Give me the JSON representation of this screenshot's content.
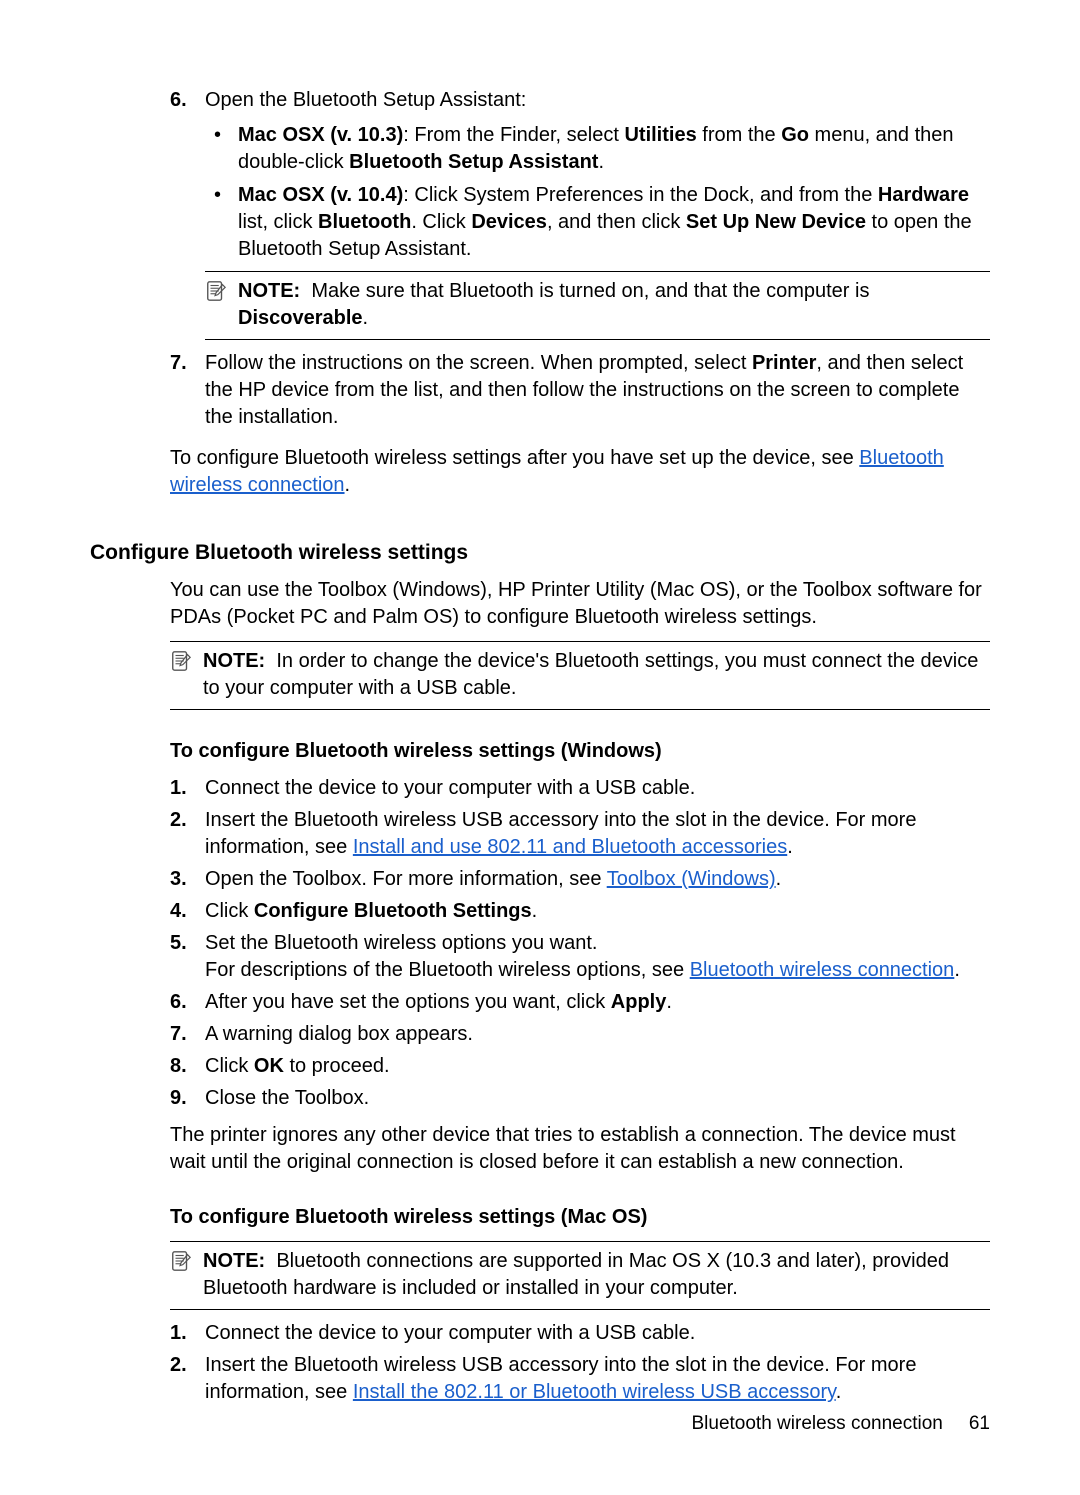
{
  "step6": {
    "num": "6.",
    "text": "Open the Bluetooth Setup Assistant:",
    "bul_a": {
      "lead_bold": "Mac OSX (v. 10.3)",
      "colon": ": From the Finder, select ",
      "u1": "Utilities",
      "mid1": " from the ",
      "u2": "Go",
      "mid2": " menu, and then double-click ",
      "u3": "Bluetooth Setup Assistant",
      "end": "."
    },
    "bul_b": {
      "lead_bold": "Mac OSX (v. 10.4)",
      "colon": ": Click System Preferences in the Dock, and from the ",
      "u1": "Hardware",
      "mid1": " list, click ",
      "u2": "Bluetooth",
      "mid2": ". Click ",
      "u3": "Devices",
      "mid3": ", and then click ",
      "u4": "Set Up New Device",
      "end": " to open the Bluetooth Setup Assistant."
    }
  },
  "note1": {
    "label": "NOTE:",
    "t1": "Make sure that Bluetooth is turned on, and that the computer is ",
    "b1": "Discoverable",
    "t2": "."
  },
  "step7": {
    "num": "7.",
    "t1": "Follow the instructions on the screen. When prompted, select ",
    "b1": "Printer",
    "t2": ", and then select the HP device from the list, and then follow the instructions on the screen to complete the installation."
  },
  "para_after7": {
    "t1": "To configure Bluetooth wireless settings after you have set up the device, see ",
    "link": "Bluetooth wireless connection",
    "t2": "."
  },
  "sec1": {
    "heading": "Configure Bluetooth wireless settings",
    "intro": "You can use the Toolbox (Windows), HP Printer Utility (Mac OS), or the Toolbox software for PDAs (Pocket PC and Palm OS) to configure Bluetooth wireless settings."
  },
  "note2": {
    "label": "NOTE:",
    "text": "In order to change the device's Bluetooth settings, you must connect the device to your computer with a USB cable."
  },
  "win": {
    "heading": "To configure Bluetooth wireless settings (Windows)",
    "s1": {
      "num": "1.",
      "text": "Connect the device to your computer with a USB cable."
    },
    "s2": {
      "num": "2.",
      "t1": "Insert the Bluetooth wireless USB accessory into the slot in the device. For more information, see ",
      "link": "Install and use 802.11 and Bluetooth accessories",
      "t2": "."
    },
    "s3": {
      "num": "3.",
      "t1": "Open the Toolbox. For more information, see ",
      "link": "Toolbox (Windows)",
      "t2": "."
    },
    "s4": {
      "num": "4.",
      "t1": "Click ",
      "b1": "Configure Bluetooth Settings",
      "t2": "."
    },
    "s5": {
      "num": "5.",
      "l1": "Set the Bluetooth wireless options you want.",
      "l2a": "For descriptions of the Bluetooth wireless options, see ",
      "link": "Bluetooth wireless connection",
      "l2b": "."
    },
    "s6": {
      "num": "6.",
      "t1": "After you have set the options you want, click ",
      "b1": "Apply",
      "t2": "."
    },
    "s7": {
      "num": "7.",
      "text": "A warning dialog box appears."
    },
    "s8": {
      "num": "8.",
      "t1": "Click ",
      "b1": "OK",
      "t2": " to proceed."
    },
    "s9": {
      "num": "9.",
      "text": "Close the Toolbox."
    },
    "after": "The printer ignores any other device that tries to establish a connection. The device must wait until the original connection is closed before it can establish a new connection."
  },
  "mac": {
    "heading": "To configure Bluetooth wireless settings (Mac OS)",
    "note": {
      "label": "NOTE:",
      "text": "Bluetooth connections are supported in Mac OS X (10.3 and later), provided Bluetooth hardware is included or installed in your computer."
    },
    "s1": {
      "num": "1.",
      "text": "Connect the device to your computer with a USB cable."
    },
    "s2": {
      "num": "2.",
      "t1": "Insert the Bluetooth wireless USB accessory into the slot in the device. For more information, see ",
      "link": "Install the 802.11 or Bluetooth wireless USB accessory",
      "t2": "."
    }
  },
  "footer": {
    "text": "Bluetooth wireless connection",
    "page": "61"
  }
}
